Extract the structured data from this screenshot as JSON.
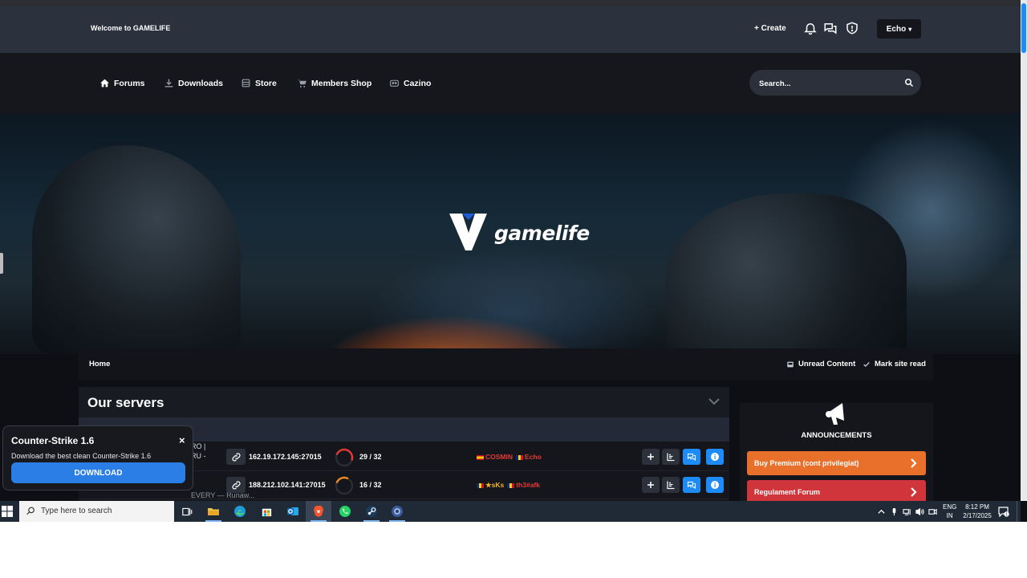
{
  "header": {
    "welcome": "Welcome to GAMELIFE",
    "create_label": "+ Create",
    "user_label": "Echo"
  },
  "nav": {
    "items": [
      {
        "label": "Forums",
        "icon": "home-icon"
      },
      {
        "label": "Downloads",
        "icon": "download-icon"
      },
      {
        "label": "Store",
        "icon": "store-icon"
      },
      {
        "label": "Members Shop",
        "icon": "cart-icon"
      },
      {
        "label": "Cazino",
        "icon": "casino-icon"
      }
    ],
    "search_placeholder": "Search..."
  },
  "banner": {
    "logo_text": "gamelife"
  },
  "breadcrumb": {
    "home": "Home",
    "unread": "Unread Content",
    "mark_read": "Mark site read"
  },
  "servers": {
    "title": "Our servers",
    "rows": [
      {
        "name_lines": [
          "RO |",
          "RU -"
        ],
        "ip": "162.19.172.145:27015",
        "players": "29 / 32",
        "fill": 0.906,
        "gauge_color": "#e53935",
        "online": [
          {
            "name": "COSMIN",
            "flag": "es",
            "color": "#e53935"
          },
          {
            "name": "Echo",
            "flag": "ro",
            "color": "#e53935"
          }
        ]
      },
      {
        "name_lines": [
          "EVERY — Runaw..."
        ],
        "ip": "188.212.102.141:27015",
        "players": "16 / 32",
        "fill": 0.5,
        "gauge_color": "#f08a24",
        "online": [
          {
            "name": "★sKs",
            "flag": "ro",
            "color": "#f0b429"
          },
          {
            "name": "th3#afk",
            "flag": "ro",
            "color": "#e53935"
          }
        ]
      }
    ]
  },
  "sidebar": {
    "title": "ANNOUNCEMENTS",
    "links": [
      {
        "label": "Buy Premium (cont privilegiat)",
        "color": "#e8702a"
      },
      {
        "label": "Regulament Forum",
        "color": "#d0353b"
      }
    ]
  },
  "popup": {
    "title": "Counter-Strike 1.6",
    "description": "Download the best clean Counter-Strike 1.6",
    "button": "DOWNLOAD",
    "close": "×"
  },
  "taskbar": {
    "search_placeholder": "Type here to search",
    "lang_line1": "ENG",
    "lang_line2": "IN",
    "time": "8:12 PM",
    "date": "2/17/2025",
    "notification_count": "1"
  }
}
